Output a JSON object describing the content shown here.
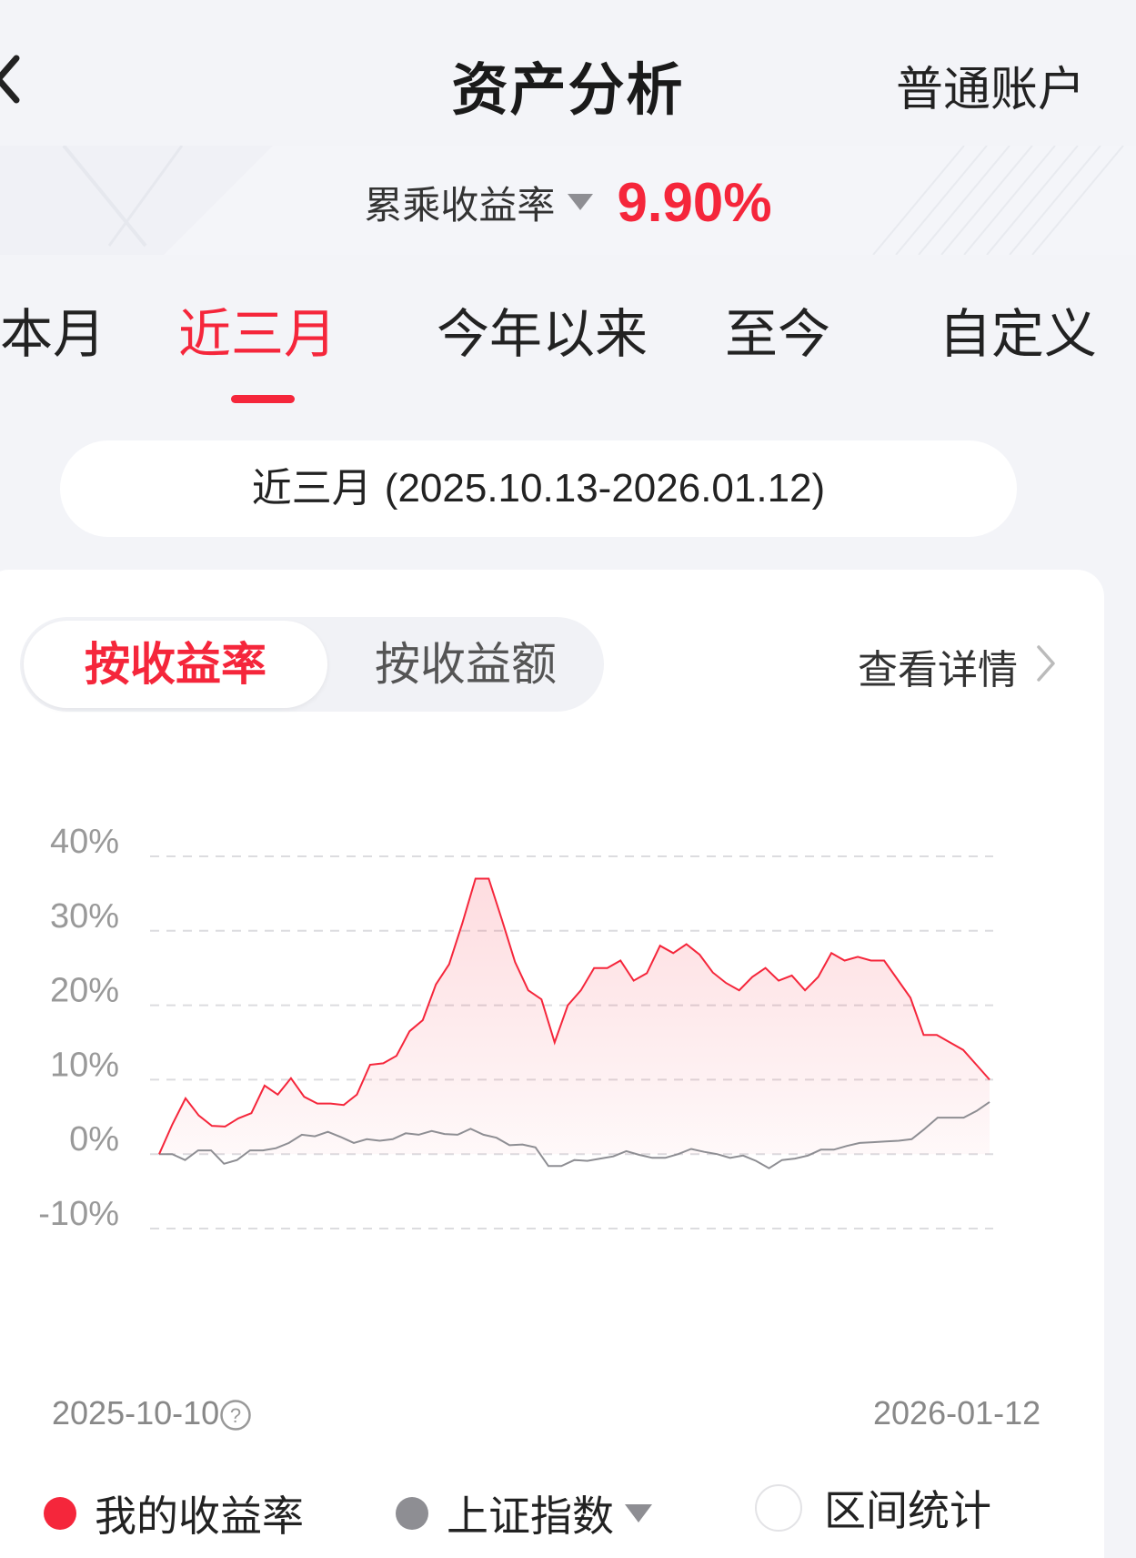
{
  "header": {
    "title": "资产分析",
    "account": "普通账户",
    "back_icon": "chevron-left-icon"
  },
  "metric": {
    "label": "累乘收益率",
    "value": "9.90%",
    "caret_icon": "triangle-down-icon"
  },
  "period_tabs": [
    {
      "label": "本月",
      "active": false
    },
    {
      "label": "近三月",
      "active": true
    },
    {
      "label": "今年以来",
      "active": false
    },
    {
      "label": "至今",
      "active": false
    },
    {
      "label": "自定义",
      "active": false
    }
  ],
  "range": {
    "label": "近三月",
    "dates": "(2025.10.13-2026.01.12)"
  },
  "toggle": {
    "by_rate": "按收益率",
    "by_amount": "按收益额",
    "active": "by_rate"
  },
  "details": {
    "label": "查看详情",
    "icon": "chevron-right-icon"
  },
  "colors": {
    "accent": "#f5263b",
    "benchmark": "#8e8e93"
  },
  "chart_data": {
    "type": "line",
    "x_start": "2025-10-10",
    "x_end": "2026-01-12",
    "ylim": [
      -10,
      40
    ],
    "y_ticks": [
      "40%",
      "30%",
      "20%",
      "10%",
      "0%",
      "-10%"
    ],
    "y_tick_values": [
      40,
      30,
      20,
      10,
      0,
      -10
    ],
    "grid": "dashed horizontal",
    "series": [
      {
        "name": "我的收益率",
        "color": "#f5263b",
        "fill": true,
        "values": [
          0,
          4,
          7.5,
          5.2,
          3.8,
          3.7,
          4.8,
          5.5,
          9.2,
          8.0,
          10.2,
          7.7,
          6.8,
          6.8,
          6.6,
          8.0,
          12.0,
          12.2,
          13.2,
          16.5,
          18.0,
          22.8,
          25.5,
          31.0,
          37.0,
          37.0,
          31.5,
          25.8,
          22.0,
          20.8,
          15.0,
          20.0,
          22.0,
          25.0,
          25.0,
          26.0,
          23.3,
          24.3,
          28.0,
          27.0,
          28.2,
          26.8,
          24.4,
          23.0,
          22.0,
          23.8,
          25.0,
          23.3,
          24.0,
          22.0,
          23.8,
          27.0,
          26.0,
          26.5,
          26.0,
          26.0,
          23.5,
          21.0,
          16.0,
          16.0,
          15.0,
          14.0,
          12.0,
          10.0
        ]
      },
      {
        "name": "上证指数",
        "color": "#8e8e93",
        "fill": false,
        "values": [
          0,
          0,
          -0.8,
          0.5,
          0.5,
          -1.3,
          -0.8,
          0.5,
          0.5,
          0.8,
          1.5,
          2.6,
          2.4,
          3.0,
          2.3,
          1.5,
          2.0,
          1.8,
          2.0,
          2.8,
          2.6,
          3.1,
          2.7,
          2.6,
          3.4,
          2.6,
          2.2,
          1.2,
          1.3,
          0.9,
          -1.6,
          -1.6,
          -0.8,
          -0.9,
          -0.6,
          -0.3,
          0.4,
          -0.1,
          -0.5,
          -0.5,
          0.0,
          0.7,
          0.3,
          0.0,
          -0.5,
          -0.2,
          -0.9,
          -1.9,
          -0.8,
          -0.6,
          -0.2,
          0.6,
          0.6,
          1.1,
          1.5,
          1.6,
          1.7,
          1.8,
          2.0,
          3.4,
          4.9,
          4.9,
          4.9,
          5.8,
          7.0
        ]
      }
    ]
  },
  "dates": {
    "start": "2025-10-10",
    "end": "2026-01-12",
    "help_icon": "question-circle-icon"
  },
  "legend": {
    "mine": "我的收益率",
    "index": "上证指数",
    "stats": "区间统计"
  }
}
